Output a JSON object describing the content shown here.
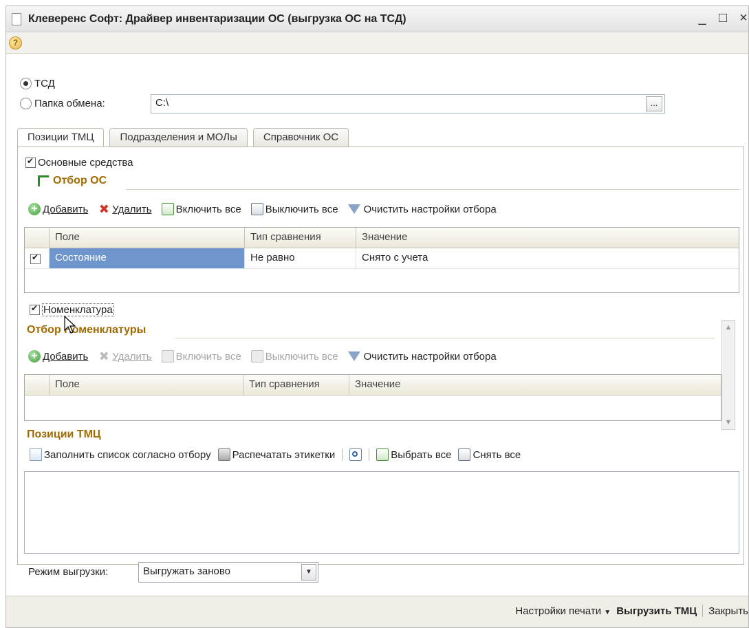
{
  "window": {
    "title": "Клеверенс Софт: Драйвер инвентаризации ОС (выгрузка ОС на ТСД)",
    "controls": [
      "_",
      "□",
      "×"
    ]
  },
  "icons": {
    "help": "help-icon",
    "document": "document-icon"
  },
  "target": {
    "tsd_label": "ТСД",
    "folder_label": "Папка обмена:",
    "folder_value": "C:\\",
    "browse_label": "...",
    "selected": "ТСД"
  },
  "tabs": [
    {
      "label": "Позиции ТМЦ",
      "active": true
    },
    {
      "label": "Подразделения и МОЛы",
      "active": false
    },
    {
      "label": "Справочник ОС",
      "active": false
    }
  ],
  "os_section": {
    "checkbox_label": "Основные средства",
    "checked": true,
    "filter_title": "Отбор ОС",
    "toolbar": {
      "add": "Добавить",
      "delete": "Удалить",
      "enable_all": "Включить все",
      "disable_all": "Выключить все",
      "clear": "Очистить настройки отбора"
    },
    "columns": [
      "Поле",
      "Тип сравнения",
      "Значение"
    ],
    "rows": [
      {
        "checked": true,
        "field": "Состояние",
        "comparison": "Не равно",
        "value": "Снято с учета"
      }
    ]
  },
  "nom_section": {
    "checkbox_label": "Номенклатура",
    "checked": true,
    "filter_title": "Отбор Номенклатуры",
    "toolbar": {
      "add": "Добавить",
      "delete": "Удалить",
      "enable_all": "Включить все",
      "disable_all": "Выключить все",
      "clear": "Очистить настройки отбора"
    },
    "columns": [
      "Поле",
      "Тип сравнения",
      "Значение"
    ]
  },
  "positions": {
    "title": "Позиции ТМЦ",
    "toolbar": {
      "fill": "Заполнить список согласно отбору",
      "print_labels": "Распечатать этикетки",
      "select_all": "Выбрать все",
      "unselect_all": "Снять все"
    }
  },
  "export_mode": {
    "label": "Режим выгрузки:",
    "value": "Выгружать заново"
  },
  "footer": {
    "print_settings": "Настройки печати",
    "export": "Выгрузить ТМЦ",
    "close": "Закрыть"
  }
}
